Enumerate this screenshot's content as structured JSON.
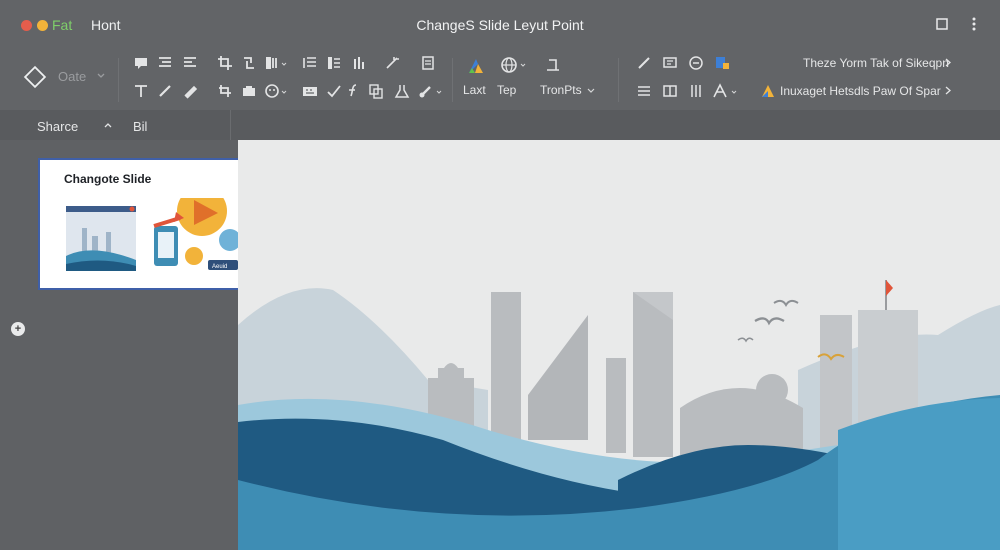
{
  "window": {
    "app_label": "Fat",
    "menu_label": "Hont",
    "title": "ChangeS Slide Leyut Point",
    "traffic_lights": [
      "#e45d4c",
      "#f2b33a",
      "#5fc24b"
    ]
  },
  "ribbon": {
    "shape_label": "Oate",
    "layout_label": "Laxt",
    "top_label": "Tep",
    "transitions_label": "TronPts",
    "right_line_1": "Theze Yorm Tak of Sikeqpn",
    "right_line_2": "Inuxaget Hetsdls Paw Of Spar"
  },
  "subbar": {
    "share_label": "Sharce",
    "bil_label": "Bil"
  },
  "thumbnail": {
    "title": "Changote Slide",
    "badge_label": "Aeuid"
  },
  "colors": {
    "accent_blue": "#3f5fa8",
    "wave_dark": "#1f5a82",
    "wave_mid": "#3e8db4",
    "wave_light": "#9cc8dc",
    "flag": "#e0553a",
    "bird": "#d8a23a"
  }
}
